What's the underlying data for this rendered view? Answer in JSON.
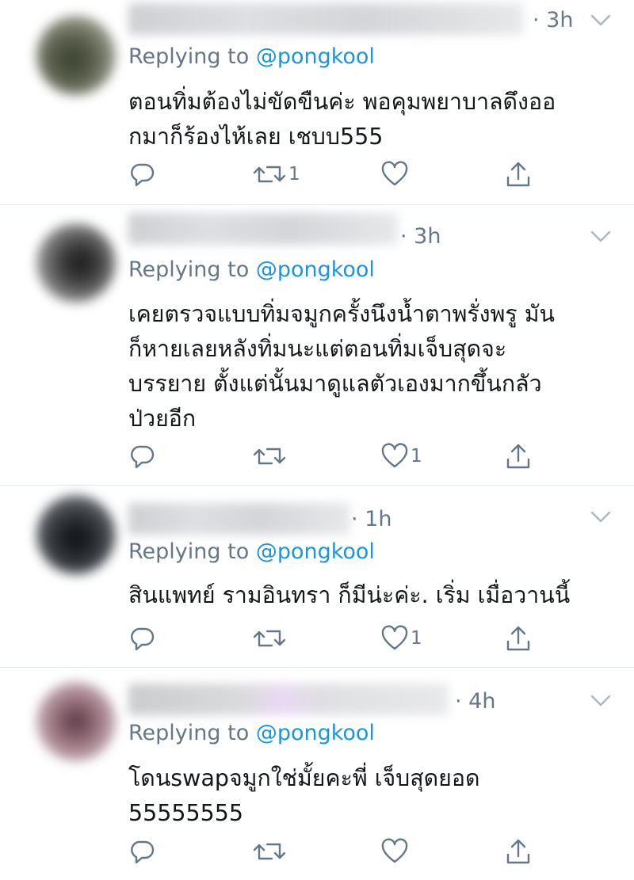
{
  "colors": {
    "link": "#1b95e0",
    "muted": "#657786",
    "text": "#14171a",
    "divider": "#e1e8ed"
  },
  "tweets": [
    {
      "time": "· 3h",
      "replying_prefix": "Replying to ",
      "handle": "@pongkool",
      "text": [
        "ตอนทิ่มต้องไม่ขัดขืนค่ะ พอคุมพยาบาลดึงออ",
        "กมาก็ร้องไห้เลย เชบบ555"
      ],
      "actions": {
        "reply": "",
        "retweet": "1",
        "like": "",
        "share": ""
      }
    },
    {
      "time": "· 3h",
      "replying_prefix": "Replying to ",
      "handle": "@pongkool",
      "text": [
        "เคยตรวจแบบทิ่มจมูกครั้งนึงน้ำตาพรั่งพรู มัน",
        "ก็หายเลยหลังทิ่มนะแต่ตอนทิ่มเจ็บสุดจะ",
        "บรรยาย ตั้งแต่นั้นมาดูแลตัวเองมากขึ้นกลัว",
        "ป่วยอีก"
      ],
      "actions": {
        "reply": "",
        "retweet": "",
        "like": "1",
        "share": ""
      }
    },
    {
      "time": "· 1h",
      "replying_prefix": "Replying to ",
      "handle": "@pongkool",
      "text": [
        "สินแพทย์ รามอินทรา ก็มีน่ะค่ะ. เริ่ม เมื่อวานนี้"
      ],
      "actions": {
        "reply": "",
        "retweet": "",
        "like": "1",
        "share": ""
      }
    },
    {
      "time": "· 4h",
      "replying_prefix": "Replying to ",
      "handle": "@pongkool",
      "text": [
        "โดนswapจมูกใช่มั้ยคะพี่ เจ็บสุดยอด",
        "55555555"
      ],
      "actions": {
        "reply": "",
        "retweet": "",
        "like": "",
        "share": ""
      }
    }
  ]
}
